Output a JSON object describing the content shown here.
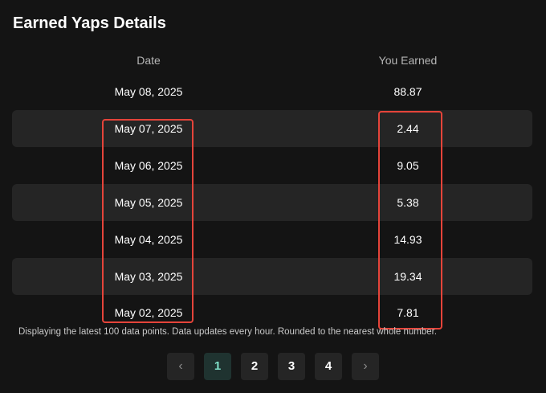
{
  "title": "Earned Yaps Details",
  "table": {
    "headers": {
      "date": "Date",
      "earned": "You Earned"
    },
    "rows": [
      {
        "date": "May 08, 2025",
        "earned": "88.87"
      },
      {
        "date": "May 07, 2025",
        "earned": "2.44"
      },
      {
        "date": "May 06, 2025",
        "earned": "9.05"
      },
      {
        "date": "May 05, 2025",
        "earned": "5.38"
      },
      {
        "date": "May 04, 2025",
        "earned": "14.93"
      },
      {
        "date": "May 03, 2025",
        "earned": "19.34"
      },
      {
        "date": "May 02, 2025",
        "earned": "7.81"
      }
    ]
  },
  "footnote": "Displaying the latest 100 data points. Data updates every hour. Rounded to the nearest whole number.",
  "pagination": {
    "prev_icon": "‹",
    "next_icon": "›",
    "pages": [
      "1",
      "2",
      "3",
      "4"
    ],
    "current": "1"
  },
  "colors": {
    "background": "#141414",
    "row_shade": "#252525",
    "highlight": "#e5443a",
    "active_page": "#7fe0c8"
  }
}
